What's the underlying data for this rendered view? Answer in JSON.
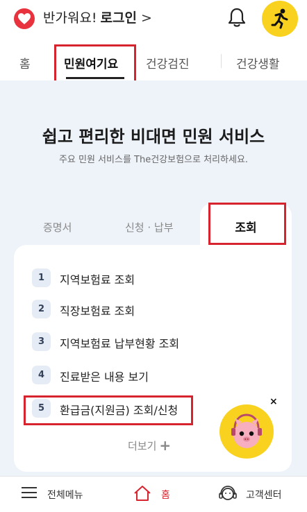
{
  "header": {
    "greeting": "반가워요!",
    "login_label": "로그인",
    "chevron": ">",
    "logo_icon": "heart-logo-icon",
    "notification_icon": "bell-icon",
    "profile_icon": "runner-icon",
    "brand_color": "#e8333e",
    "profile_bg": "#f9d21f"
  },
  "tabs": [
    {
      "label": "홈",
      "active": false
    },
    {
      "label": "민원여기요",
      "active": true
    },
    {
      "label": "건강검진",
      "active": false
    },
    {
      "label": "건강생활",
      "active": false
    }
  ],
  "hero": {
    "title": "쉽고 편리한 비대면 민원 서비스",
    "subtitle": "주요 민원 서비스를 The건강보험으로 처리하세요."
  },
  "subtabs": [
    {
      "label": "증명서",
      "active": false
    },
    {
      "label": "신청 · 납부",
      "active": false
    },
    {
      "label": "조회",
      "active": true
    }
  ],
  "services": [
    {
      "num": "1",
      "label": "지역보험료 조회"
    },
    {
      "num": "2",
      "label": "직장보험료 조회"
    },
    {
      "num": "3",
      "label": "지역보험료 납부현황 조회"
    },
    {
      "num": "4",
      "label": "진료받은 내용 보기"
    },
    {
      "num": "5",
      "label": "환급금(지원금) 조회/신청"
    }
  ],
  "more_label": "더보기",
  "more_icon": "plus-icon",
  "chatbot": {
    "close": "×",
    "mascot_icon": "mascot-icon"
  },
  "bottom_nav": [
    {
      "label": "전체메뉴",
      "icon": "hamburger-icon"
    },
    {
      "label": "홈",
      "icon": "home-icon",
      "active": true
    },
    {
      "label": "고객센터",
      "icon": "headset-icon"
    }
  ],
  "colors": {
    "accent_red": "#d7232e",
    "background_blue": "#eef3fa",
    "number_badge": "#e6ecf5"
  }
}
